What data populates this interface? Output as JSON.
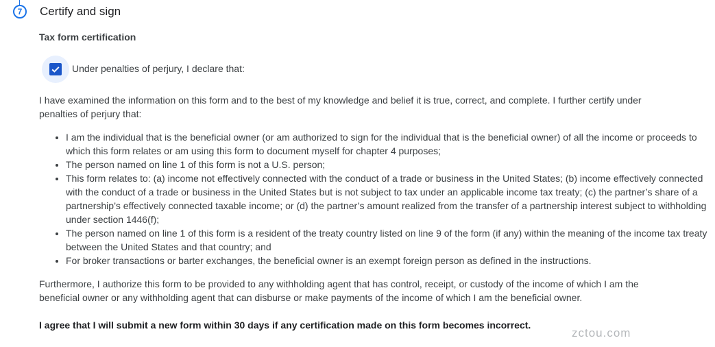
{
  "step": {
    "number": "7",
    "title": "Certify and sign"
  },
  "section": {
    "heading": "Tax form certification"
  },
  "checkbox": {
    "label": "Under penalties of perjury, I declare that:",
    "checked": true,
    "color": "#1a56c9"
  },
  "certification": {
    "intro": "I have examined the information on this form and to the best of my knowledge and belief it is true, correct, and complete. I further certify under penalties of perjury that:",
    "items": [
      "I am the individual that is the beneficial owner (or am authorized to sign for the individual that is the beneficial owner) of all the income or proceeds to which this form relates or am using this form to document myself for chapter 4 purposes;",
      "The person named on line 1 of this form is not a U.S. person;",
      "This form relates to: (a) income not effectively connected with the conduct of a trade or business in the United States; (b) income effectively connected with the conduct of a trade or business in the United States but is not subject to tax under an applicable income tax treaty; (c) the partner’s share of a partnership’s effectively connected taxable income; or (d) the partner’s amount realized from the transfer of a partnership interest subject to withholding under section 1446(f);",
      "The person named on line 1 of this form is a resident of the treaty country listed on line 9 of the form (if any) within the meaning of the income tax treaty between the United States and that country; and",
      "For broker transactions or barter exchanges, the beneficial owner is an exempt foreign person as defined in the instructions."
    ],
    "furthermore": "Furthermore, I authorize this form to be provided to any withholding agent that has control, receipt, or custody of the income of which I am the beneficial owner or any withholding agent that can disburse or make payments of the income of which I am the beneficial owner.",
    "agreement": "I agree that I will submit a new form within 30 days if any certification made on this form becomes incorrect."
  },
  "watermark": "zctou.com",
  "colors": {
    "accent": "#1a73e8"
  }
}
